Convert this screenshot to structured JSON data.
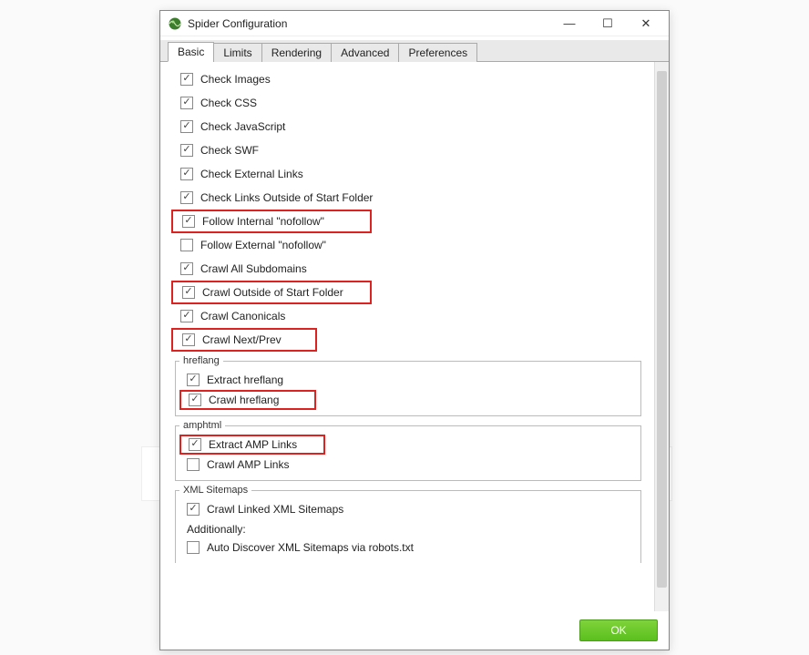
{
  "window": {
    "title": "Spider Configuration"
  },
  "tabs": [
    {
      "label": "Basic",
      "active": true
    },
    {
      "label": "Limits",
      "active": false
    },
    {
      "label": "Rendering",
      "active": false
    },
    {
      "label": "Advanced",
      "active": false
    },
    {
      "label": "Preferences",
      "active": false
    }
  ],
  "checks": {
    "images": {
      "label": "Check Images",
      "checked": true,
      "hl": false
    },
    "css": {
      "label": "Check CSS",
      "checked": true,
      "hl": false
    },
    "js": {
      "label": "Check JavaScript",
      "checked": true,
      "hl": false
    },
    "swf": {
      "label": "Check SWF",
      "checked": true,
      "hl": false
    },
    "extlinks": {
      "label": "Check External Links",
      "checked": true,
      "hl": false
    },
    "outside": {
      "label": "Check Links Outside of Start Folder",
      "checked": true,
      "hl": false
    },
    "intnof": {
      "label": "Follow Internal \"nofollow\"",
      "checked": true,
      "hl": true
    },
    "extnof": {
      "label": "Follow External \"nofollow\"",
      "checked": false,
      "hl": false
    },
    "subdom": {
      "label": "Crawl All Subdomains",
      "checked": true,
      "hl": false
    },
    "crawlout": {
      "label": "Crawl Outside of Start Folder",
      "checked": true,
      "hl": true
    },
    "canon": {
      "label": "Crawl Canonicals",
      "checked": true,
      "hl": false
    },
    "nextprev": {
      "label": "Crawl Next/Prev",
      "checked": true,
      "hl": true
    }
  },
  "hreflang": {
    "legend": "hreflang",
    "extract": {
      "label": "Extract hreflang",
      "checked": true,
      "hl": false
    },
    "crawl": {
      "label": "Crawl hreflang",
      "checked": true,
      "hl": true
    }
  },
  "amphtml": {
    "legend": "amphtml",
    "extract": {
      "label": "Extract AMP Links",
      "checked": true,
      "hl": true
    },
    "crawl": {
      "label": "Crawl AMP Links",
      "checked": false,
      "hl": false
    }
  },
  "xmlsitemaps": {
    "legend": "XML Sitemaps",
    "crawl_linked": {
      "label": "Crawl Linked XML Sitemaps",
      "checked": true
    },
    "additionally": "Additionally:",
    "auto_discover": {
      "label": "Auto Discover XML Sitemaps via robots.txt",
      "checked": false
    }
  },
  "footer": {
    "ok": "OK"
  }
}
